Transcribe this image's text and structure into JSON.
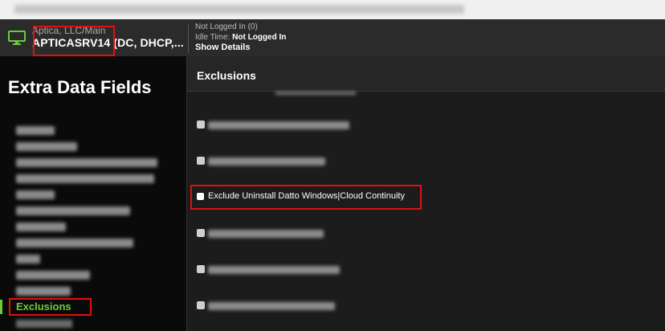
{
  "device": {
    "site": "Aptica, LLC/Main",
    "name": "APTICASRV14 (DC, DHCP,..."
  },
  "status": {
    "line1": "Not Logged In (0)",
    "idle_label": "Idle Time:",
    "idle_value": "Not Logged In",
    "details_label": "Show Details"
  },
  "sidebar": {
    "title": "Extra Data Fields",
    "active_item": "Exclusions"
  },
  "main": {
    "title": "Exclusions",
    "highlighted_option": "Exclude Uninstall Datto Windows|Cloud Continuity"
  },
  "colors": {
    "accent": "#6ccb3c",
    "highlight": "#e01010"
  }
}
